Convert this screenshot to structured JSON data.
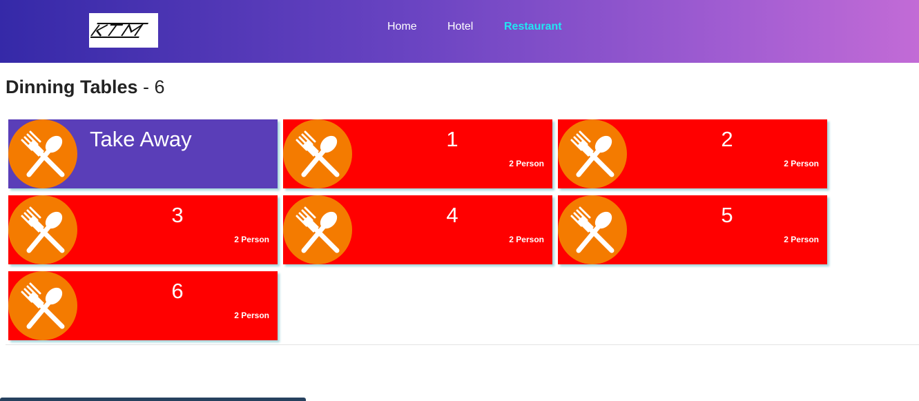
{
  "header": {
    "logo_text": "KTM",
    "nav": [
      {
        "label": "Home",
        "active": false
      },
      {
        "label": "Hotel",
        "active": false
      },
      {
        "label": "Restaurant",
        "active": true
      }
    ]
  },
  "page": {
    "title": "Dinning Tables",
    "count_text": " - 6"
  },
  "tables": [
    {
      "name": "Take Away",
      "capacity": "",
      "color": "#5a3eb8",
      "icon": "fork-spoon-icon"
    },
    {
      "name": "1",
      "capacity": "2 Person",
      "color": "#ff0000",
      "icon": "fork-spoon-icon"
    },
    {
      "name": "2",
      "capacity": "2 Person",
      "color": "#ff0000",
      "icon": "fork-spoon-icon"
    },
    {
      "name": "3",
      "capacity": "2 Person",
      "color": "#ff0000",
      "icon": "fork-spoon-icon"
    },
    {
      "name": "4",
      "capacity": "2 Person",
      "color": "#ff0000",
      "icon": "fork-spoon-icon"
    },
    {
      "name": "5",
      "capacity": "2 Person",
      "color": "#ff0000",
      "icon": "fork-spoon-icon"
    },
    {
      "name": "6",
      "capacity": "2 Person",
      "color": "#ff0000",
      "icon": "fork-spoon-icon"
    }
  ],
  "colors": {
    "header_gradient_start": "#3529a8",
    "header_gradient_end": "#c26bd6",
    "nav_active": "#22e6f2",
    "icon_circle": "#f47b00"
  }
}
